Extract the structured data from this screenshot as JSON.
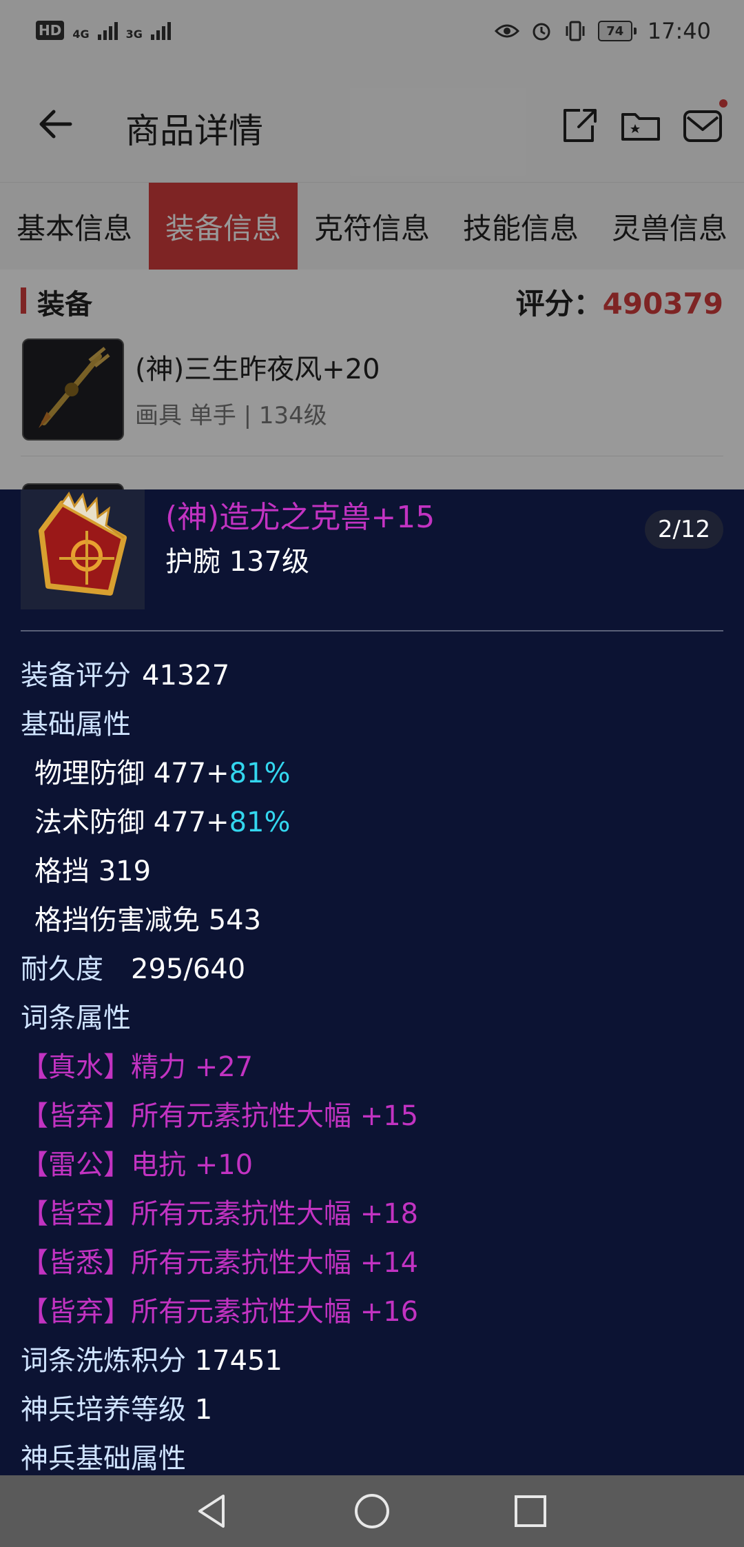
{
  "status_bar": {
    "hd": "HD",
    "net1": "4G",
    "net2": "3G",
    "battery": "74",
    "time": "17:40"
  },
  "header": {
    "title": "商品详情",
    "icons": [
      "back-arrow-icon",
      "share-icon",
      "folder-star-icon",
      "mail-icon"
    ]
  },
  "tabs": [
    {
      "label": "基本信息",
      "active": false
    },
    {
      "label": "装备信息",
      "active": true
    },
    {
      "label": "克符信息",
      "active": false
    },
    {
      "label": "技能信息",
      "active": false
    },
    {
      "label": "灵兽信息",
      "active": false
    }
  ],
  "equipment_section": {
    "title": "装备",
    "score_label": "评分：",
    "score_value": "490379",
    "items": [
      {
        "name": "(神)三生昨夜风+20",
        "sub": "画具 单手 | 134级"
      }
    ]
  },
  "detail": {
    "name": "(神)造尤之克兽+15",
    "type": "护腕  137级",
    "page": "2/12",
    "equip_score_label": "装备评分",
    "equip_score_value": "41327",
    "base_attr_label": "基础属性",
    "base_attrs": [
      {
        "name": "物理防御",
        "value": "477+",
        "extra": "81%"
      },
      {
        "name": "法术防御",
        "value": "477+",
        "extra": "81%"
      },
      {
        "name": "格挡",
        "value": "319",
        "extra": ""
      },
      {
        "name": "格挡伤害减免",
        "value": "543",
        "extra": ""
      }
    ],
    "durability_label": "耐久度",
    "durability_value": "295/640",
    "affix_label": "词条属性",
    "affixes": [
      {
        "tag": "【真水】",
        "text": "精力 +27"
      },
      {
        "tag": "【皆弃】",
        "text": "所有元素抗性大幅 +15"
      },
      {
        "tag": "【雷公】",
        "text": "电抗 +10"
      },
      {
        "tag": "【皆空】",
        "text": "所有元素抗性大幅 +18"
      },
      {
        "tag": "【皆悉】",
        "text": "所有元素抗性大幅 +14"
      },
      {
        "tag": "【皆弃】",
        "text": "所有元素抗性大幅 +16"
      }
    ],
    "refine_label": "词条洗炼积分",
    "refine_value": "17451",
    "train_label": "神兵培养等级",
    "train_value": "1",
    "weapon_base_label": "神兵基础属性"
  },
  "nav_bar": {
    "icons": [
      "back-triangle-icon",
      "home-circle-icon",
      "recents-square-icon"
    ]
  },
  "colors": {
    "accent_red": "#d23c3c",
    "panel_bg": "#0c1333",
    "magenta": "#c233c2",
    "cyan": "#33d6ee"
  }
}
